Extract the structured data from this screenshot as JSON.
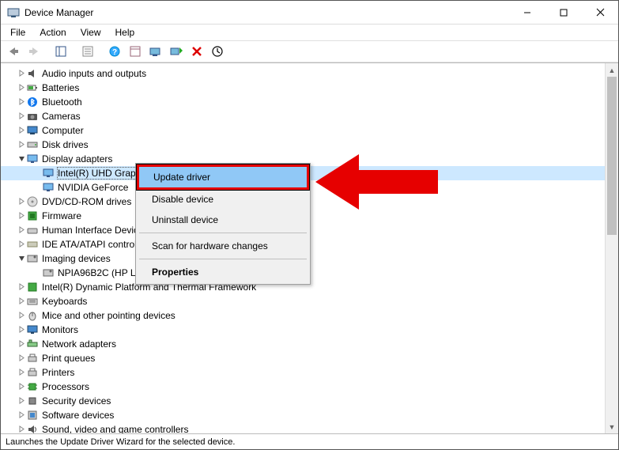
{
  "window": {
    "title": "Device Manager"
  },
  "menu": {
    "file": "File",
    "action": "Action",
    "view": "View",
    "help": "Help"
  },
  "tree": [
    {
      "expander": ">",
      "icon": "audio",
      "label": "Audio inputs and outputs",
      "indent": 0
    },
    {
      "expander": ">",
      "icon": "battery",
      "label": "Batteries",
      "indent": 0
    },
    {
      "expander": ">",
      "icon": "bluetooth",
      "label": "Bluetooth",
      "indent": 0
    },
    {
      "expander": ">",
      "icon": "camera",
      "label": "Cameras",
      "indent": 0
    },
    {
      "expander": ">",
      "icon": "computer",
      "label": "Computer",
      "indent": 0
    },
    {
      "expander": ">",
      "icon": "disk",
      "label": "Disk drives",
      "indent": 0
    },
    {
      "expander": "v",
      "icon": "display",
      "label": "Display adapters",
      "indent": 0
    },
    {
      "expander": "",
      "icon": "display",
      "label": "Intel(R) UHD Graphics 620",
      "indent": 1,
      "selected": true
    },
    {
      "expander": "",
      "icon": "display",
      "label": "NVIDIA GeForce",
      "indent": 1
    },
    {
      "expander": ">",
      "icon": "dvd",
      "label": "DVD/CD-ROM drives",
      "indent": 0
    },
    {
      "expander": ">",
      "icon": "firmware",
      "label": "Firmware",
      "indent": 0
    },
    {
      "expander": ">",
      "icon": "hid",
      "label": "Human Interface Devices",
      "indent": 0
    },
    {
      "expander": ">",
      "icon": "ide",
      "label": "IDE ATA/ATAPI controllers",
      "indent": 0
    },
    {
      "expander": "v",
      "icon": "imaging",
      "label": "Imaging devices",
      "indent": 0
    },
    {
      "expander": "",
      "icon": "imaging",
      "label": "NPIA96B2C (HP LaserJet Pro MFP M521dw)",
      "indent": 1
    },
    {
      "expander": ">",
      "icon": "platform",
      "label": "Intel(R) Dynamic Platform and Thermal Framework",
      "indent": 0
    },
    {
      "expander": ">",
      "icon": "keyboard",
      "label": "Keyboards",
      "indent": 0
    },
    {
      "expander": ">",
      "icon": "mouse",
      "label": "Mice and other pointing devices",
      "indent": 0
    },
    {
      "expander": ">",
      "icon": "monitor",
      "label": "Monitors",
      "indent": 0
    },
    {
      "expander": ">",
      "icon": "network",
      "label": "Network adapters",
      "indent": 0
    },
    {
      "expander": ">",
      "icon": "printq",
      "label": "Print queues",
      "indent": 0
    },
    {
      "expander": ">",
      "icon": "printer",
      "label": "Printers",
      "indent": 0
    },
    {
      "expander": ">",
      "icon": "cpu",
      "label": "Processors",
      "indent": 0
    },
    {
      "expander": ">",
      "icon": "security",
      "label": "Security devices",
      "indent": 0
    },
    {
      "expander": ">",
      "icon": "software",
      "label": "Software devices",
      "indent": 0
    },
    {
      "expander": ">",
      "icon": "sound",
      "label": "Sound, video and game controllers",
      "indent": 0
    }
  ],
  "context_menu": {
    "update": "Update driver",
    "disable": "Disable device",
    "uninstall": "Uninstall device",
    "scan": "Scan for hardware changes",
    "properties": "Properties"
  },
  "status": "Launches the Update Driver Wizard for the selected device."
}
